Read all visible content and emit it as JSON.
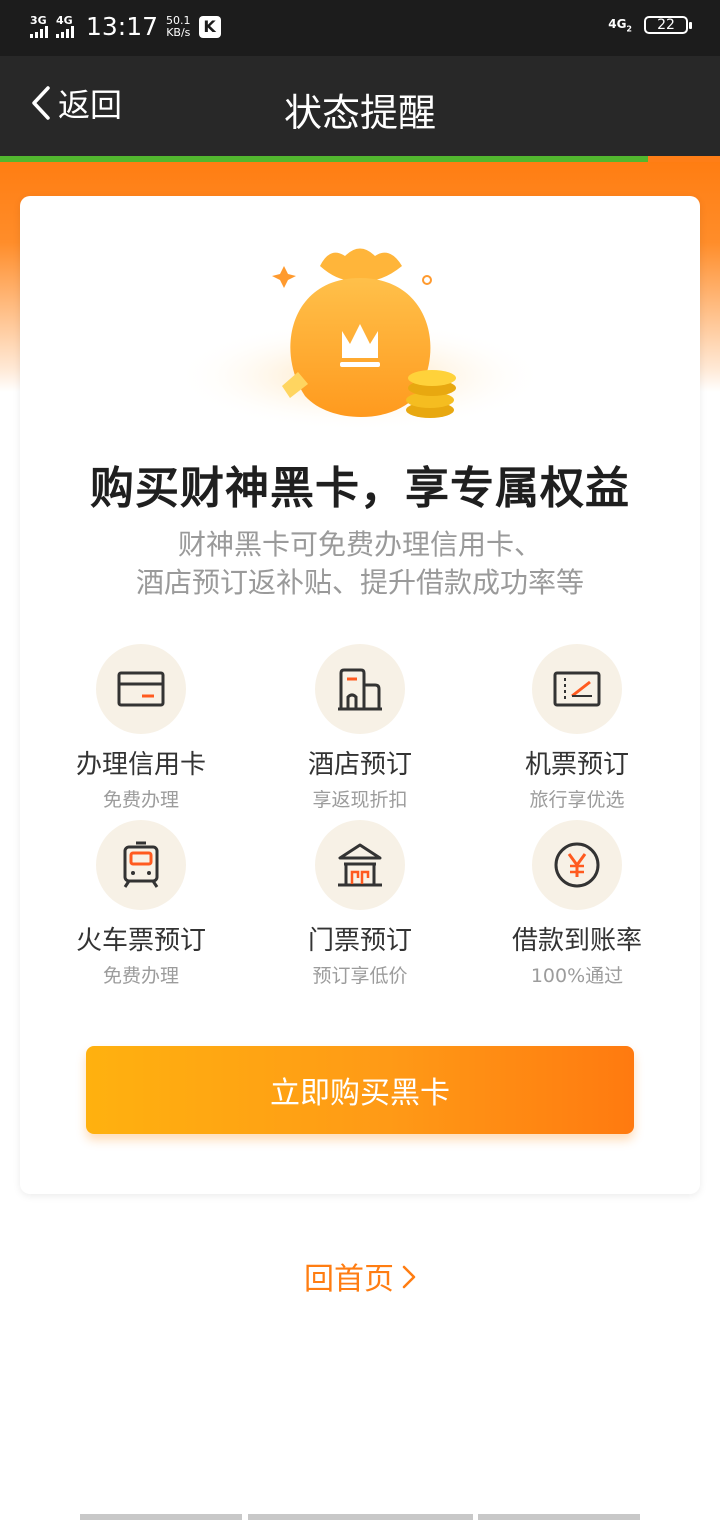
{
  "status_bar": {
    "sim1": "3G",
    "sim2": "4G",
    "time": "13:17",
    "speed_value": "50.1",
    "speed_unit": "KB/s",
    "app_badge": "K",
    "network": "4G",
    "network_sub": "2",
    "battery": "22"
  },
  "nav": {
    "back_label": "返回",
    "title": "状态提醒"
  },
  "progress": 0.9,
  "card": {
    "headline": "购买财神黑卡，享专属权益",
    "desc_line1": "财神黑卡可免费办理信用卡、",
    "desc_line2": "酒店预订返补贴、提升借款成功率等",
    "features": [
      {
        "name": "办理信用卡",
        "sub": "免费办理",
        "icon": "credit-card-icon"
      },
      {
        "name": "酒店预订",
        "sub": "享返现折扣",
        "icon": "hotel-icon"
      },
      {
        "name": "机票预订",
        "sub": "旅行享优选",
        "icon": "plane-ticket-icon"
      },
      {
        "name": "火车票预订",
        "sub": "免费办理",
        "icon": "train-icon"
      },
      {
        "name": "门票预订",
        "sub": "预订享低价",
        "icon": "pavilion-icon"
      },
      {
        "name": "借款到账率",
        "sub": "100%通过",
        "icon": "yuan-icon"
      }
    ],
    "buy_button": "立即购买黑卡"
  },
  "home_link": "回首页",
  "colors": {
    "accent": "#ff7d12",
    "icon_accent": "#ff5a1f",
    "dark": "#282828",
    "progress_green": "#52b72f"
  }
}
